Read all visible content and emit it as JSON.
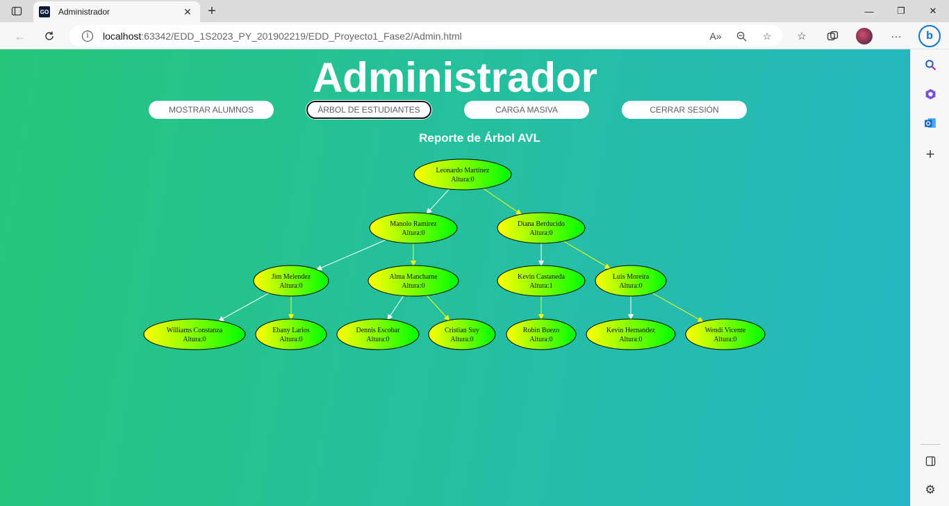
{
  "browser": {
    "tab_title": "Administrador",
    "favicon_text": "GO",
    "url_host": "localhost",
    "url_rest": ":63342/EDD_1S2023_PY_201902219/EDD_Proyecto1_Fase2/Admin.html",
    "window_controls": [
      "—",
      "❐",
      "✕"
    ]
  },
  "page": {
    "heading": "Administrador",
    "menu": [
      {
        "label": "MOSTRAR ALUMNOS"
      },
      {
        "label": "ÁRBOL DE ESTUDIANTES",
        "active": true
      },
      {
        "label": "CARGA MASIVA"
      },
      {
        "label": "CERRAR SESIÓN"
      }
    ],
    "report_title": "Reporte de Árbol AVL"
  },
  "tree": {
    "nodes": [
      {
        "id": "n1",
        "name": "Leonardo Martinez",
        "info": "Altura:0"
      },
      {
        "id": "n2",
        "name": "Manolo Ramirez",
        "info": "Altura:0"
      },
      {
        "id": "n3",
        "name": "Diana Berducido",
        "info": "Altura:0"
      },
      {
        "id": "n4",
        "name": "Jim Melendez",
        "info": "Altura:0"
      },
      {
        "id": "n5",
        "name": "Alma Manchame",
        "info": "Altura:0"
      },
      {
        "id": "n6",
        "name": "Kevin Castaneda",
        "info": "Altura:1"
      },
      {
        "id": "n7",
        "name": "Luis Moreira",
        "info": "Altura:0"
      },
      {
        "id": "n8",
        "name": "Williams Constanza",
        "info": "Altura:0"
      },
      {
        "id": "n9",
        "name": "Ebany Larios",
        "info": "Altura:0"
      },
      {
        "id": "n10",
        "name": "Dennis Escobar",
        "info": "Altura:0"
      },
      {
        "id": "n11",
        "name": "Cristian Suy",
        "info": "Altura:0"
      },
      {
        "id": "n12",
        "name": "Robin Buezo",
        "info": "Altura:0"
      },
      {
        "id": "n13",
        "name": "Kevin Hernandez",
        "info": "Altura:0"
      },
      {
        "id": "n14",
        "name": "Wendi Vicente",
        "info": "Altura:0"
      }
    ],
    "edges": [
      {
        "from": "n1",
        "to": "n2",
        "side": "left"
      },
      {
        "from": "n1",
        "to": "n3",
        "side": "right"
      },
      {
        "from": "n2",
        "to": "n4",
        "side": "left"
      },
      {
        "from": "n2",
        "to": "n5",
        "side": "right"
      },
      {
        "from": "n3",
        "to": "n6",
        "side": "left"
      },
      {
        "from": "n3",
        "to": "n7",
        "side": "right"
      },
      {
        "from": "n4",
        "to": "n8",
        "side": "left"
      },
      {
        "from": "n4",
        "to": "n9",
        "side": "right"
      },
      {
        "from": "n5",
        "to": "n10",
        "side": "left"
      },
      {
        "from": "n5",
        "to": "n11",
        "side": "right"
      },
      {
        "from": "n6",
        "to": "n12",
        "side": "right"
      },
      {
        "from": "n7",
        "to": "n13",
        "side": "left"
      },
      {
        "from": "n7",
        "to": "n14",
        "side": "right"
      }
    ],
    "colors": {
      "left_edge": "#ffffff",
      "right_edge": "#ffff00",
      "node_start": "#ffff00",
      "node_end": "#00ff00"
    }
  }
}
